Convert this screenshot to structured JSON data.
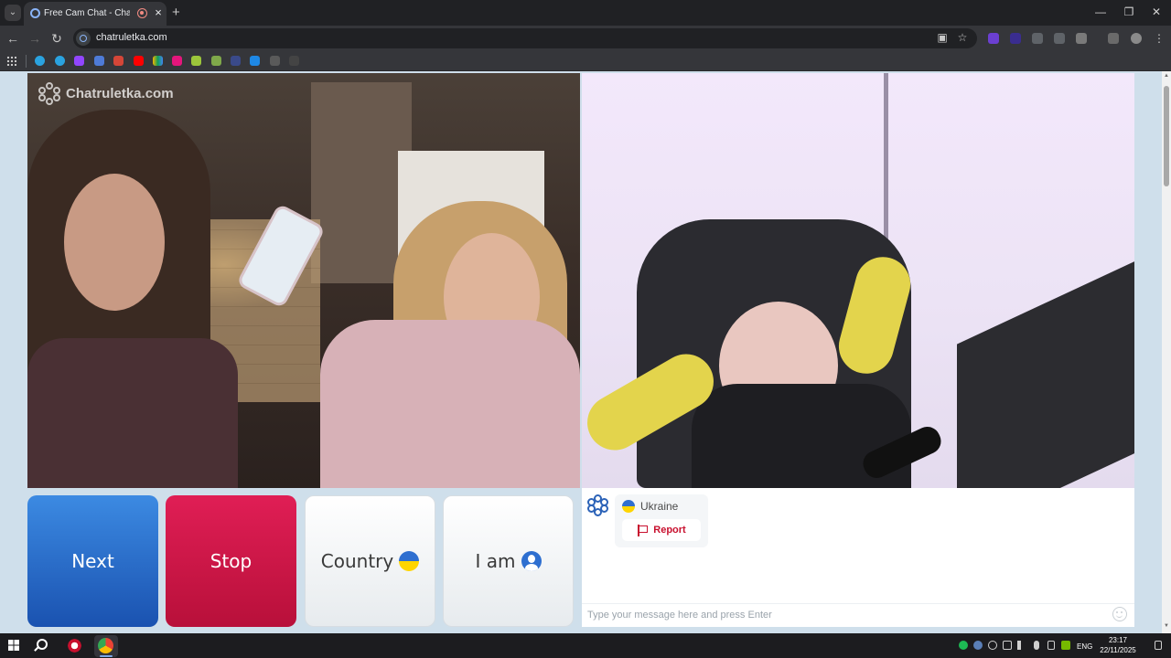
{
  "browser": {
    "tab_title": "Free Cam Chat - Chatruletka",
    "url": "chatruletka.com"
  },
  "page": {
    "brand_text": "Chatruletka.com",
    "buttons": {
      "next_label": "Next",
      "stop_label": "Stop",
      "country_label": "Country",
      "iam_label": "I am"
    },
    "chat": {
      "partner_country": "Ukraine",
      "report_label": "Report",
      "input_placeholder": "Type your message here and press Enter"
    }
  },
  "taskbar": {
    "language": "ENG",
    "time": "23:17",
    "date": "22/11/2025"
  },
  "colors": {
    "next_button": "#2463c4",
    "stop_button": "#d3174a",
    "report_red": "#c8102e",
    "page_background": "#cfdfeb"
  }
}
